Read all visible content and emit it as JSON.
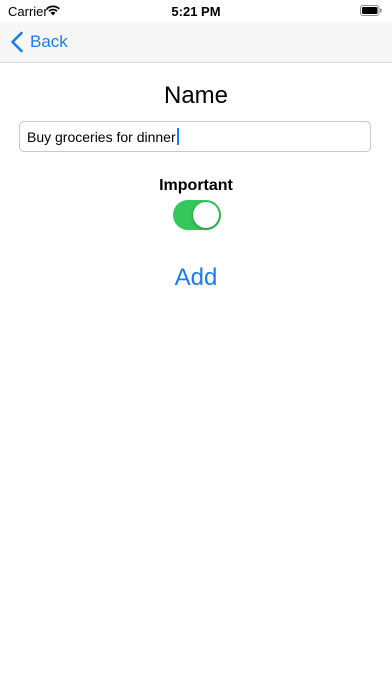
{
  "status_bar": {
    "carrier": "Carrier",
    "time": "5:21 PM",
    "wifi_icon": "wifi-icon",
    "battery_icon": "battery-icon"
  },
  "nav": {
    "back_label": "Back",
    "back_icon": "chevron-left-icon"
  },
  "form": {
    "title": "Name",
    "name_value": "Buy groceries for dinner",
    "important_label": "Important",
    "important_on": true,
    "add_label": "Add"
  },
  "colors": {
    "accent": "#1a7cf0",
    "toggle_on": "#34c759"
  }
}
